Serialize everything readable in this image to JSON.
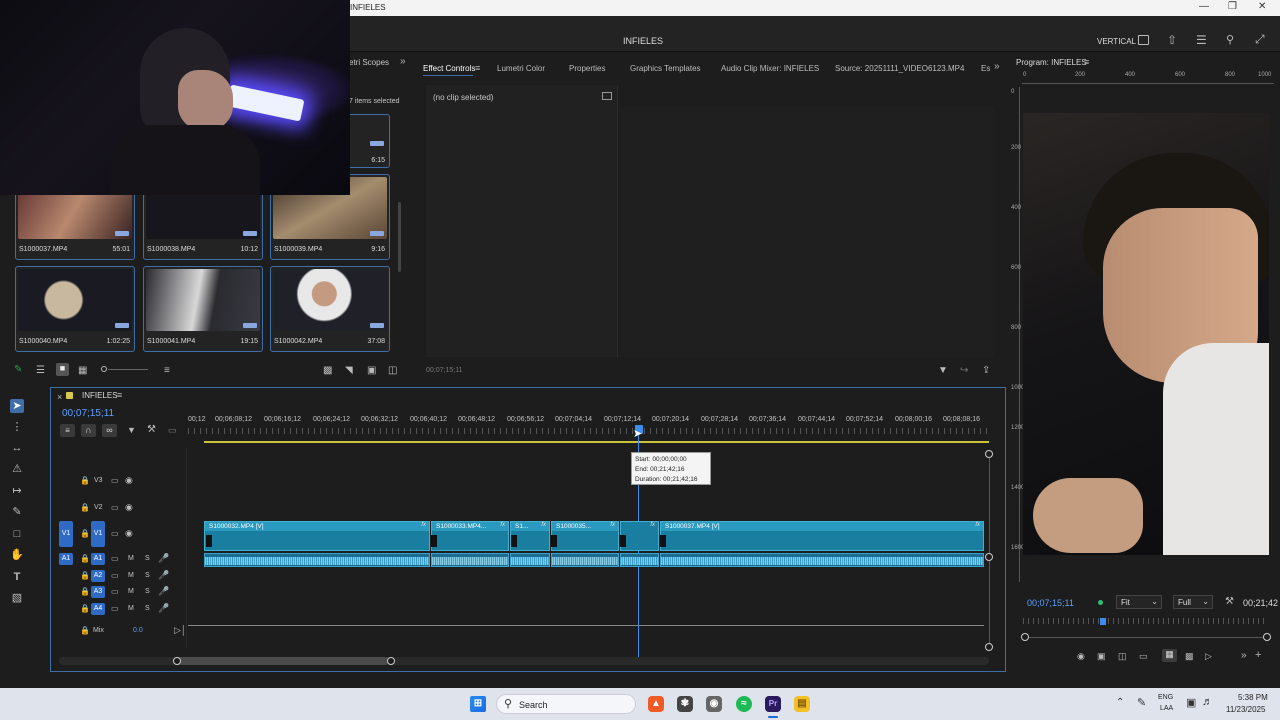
{
  "window": {
    "title": "INFIELES"
  },
  "header": {
    "project_name": "INFIELES",
    "workspace": "VERTICAL"
  },
  "project_panel": {
    "tab_partial": "etri Scopes",
    "items_selected": "7 items selected",
    "top_partial_duration": "6:15",
    "clips": [
      {
        "name": "S1000037.MP4",
        "duration": "55:01",
        "color": "#6c3a34"
      },
      {
        "name": "S1000038.MP4",
        "duration": "10:12",
        "color": "#1b1b22"
      },
      {
        "name": "S1000039.MP4",
        "duration": "9:16",
        "color": "#7a6a55"
      },
      {
        "name": "S1000040.MP4",
        "duration": "1:02:25",
        "color": "#2a2a30"
      },
      {
        "name": "S1000041.MP4",
        "duration": "19:15",
        "color": "#3d3d44"
      },
      {
        "name": "S1000042.MP4",
        "duration": "37:08",
        "color": "#2c2c36"
      }
    ]
  },
  "effect_panel": {
    "tabs": [
      "Effect Controls",
      "Lumetri Color",
      "Properties",
      "Graphics Templates",
      "Audio Clip Mixer: INFIELES",
      "Source: 20251111_VIDEO6123.MP4",
      "Es"
    ],
    "no_clip": "(no clip selected)",
    "timecode": "00;07;15;11"
  },
  "program": {
    "title": "Program: INFIELES",
    "ruler": [
      "0",
      "200",
      "400",
      "600",
      "800",
      "1000"
    ],
    "vruler": [
      "0",
      "200",
      "400",
      "600",
      "800",
      "1000",
      "1200",
      "1400",
      "1600"
    ],
    "timecode": "00;07;15;11",
    "fit": "Fit",
    "quality": "Full",
    "duration": "00;21;42"
  },
  "timeline": {
    "sequence": "INFIELES",
    "timecode": "00;07;15;11",
    "ruler_labels": [
      "00;12",
      "00;06;08;12",
      "00;06;16;12",
      "00;06;24;12",
      "00;06;32;12",
      "00;06;40;12",
      "00;06;48;12",
      "00;06;56;12",
      "00;07;04;14",
      "00;07;12;14",
      "00;07;20;14",
      "00;07;28;14",
      "00;07;36;14",
      "00;07;44;14",
      "00;07;52;14",
      "00;08;00;16",
      "00;08;08;16"
    ],
    "tooltip": {
      "start": "Start: 00;00;00;00",
      "end": "End: 00;21;42;16",
      "duration": "Duration: 00;21;42;16"
    },
    "video_tracks": [
      "V3",
      "V2",
      "V1"
    ],
    "audio_tracks": [
      "A1",
      "A2",
      "A3",
      "A4"
    ],
    "source_v": "V1",
    "source_a": "A1",
    "mix_label": "Mix",
    "mix_value": "0.0",
    "mute": "M",
    "solo": "S",
    "clips_v": [
      {
        "label": "S1000032.MP4 [V]"
      },
      {
        "label": "S1000033.MP4..."
      },
      {
        "label": "S1..."
      },
      {
        "label": "S1000035..."
      },
      {
        "label": "S1000037.MP4 [V]"
      }
    ],
    "fx": "fx"
  },
  "taskbar": {
    "search": "Search",
    "lang1": "ENG",
    "lang2": "LAA",
    "time": "5:38 PM",
    "date": "11/23/2025"
  }
}
